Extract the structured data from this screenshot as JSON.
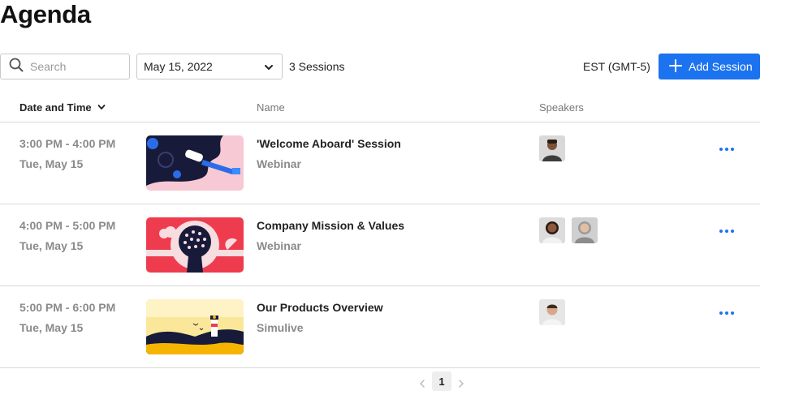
{
  "page": {
    "title": "Agenda"
  },
  "toolbar": {
    "search_placeholder": "Search",
    "date_value": "May 15, 2022",
    "session_count": "3 Sessions",
    "timezone": "EST (GMT-5)",
    "add_label": "Add Session",
    "accent": "#1b73f0"
  },
  "table": {
    "headers": {
      "date": "Date and Time",
      "name": "Name",
      "speakers": "Speakers"
    },
    "rows": [
      {
        "time": "3:00 PM - 4:00 PM",
        "day": "Tue, May 15",
        "name": "'Welcome Aboard' Session",
        "type": "Webinar",
        "speaker_count": 1
      },
      {
        "time": "4:00 PM - 5:00 PM",
        "day": "Tue, May 15",
        "name": "Company Mission & Values",
        "type": "Webinar",
        "speaker_count": 2
      },
      {
        "time": "5:00 PM - 6:00 PM",
        "day": "Tue, May 15",
        "name": "Our Products Overview",
        "type": "Simulive",
        "speaker_count": 1
      }
    ]
  },
  "pagination": {
    "current_page": "1"
  },
  "icons": [
    "search-icon",
    "chevron-down-icon",
    "plus-icon",
    "sort-caret-icon",
    "more-icon",
    "chevron-left-icon",
    "chevron-right-icon"
  ]
}
